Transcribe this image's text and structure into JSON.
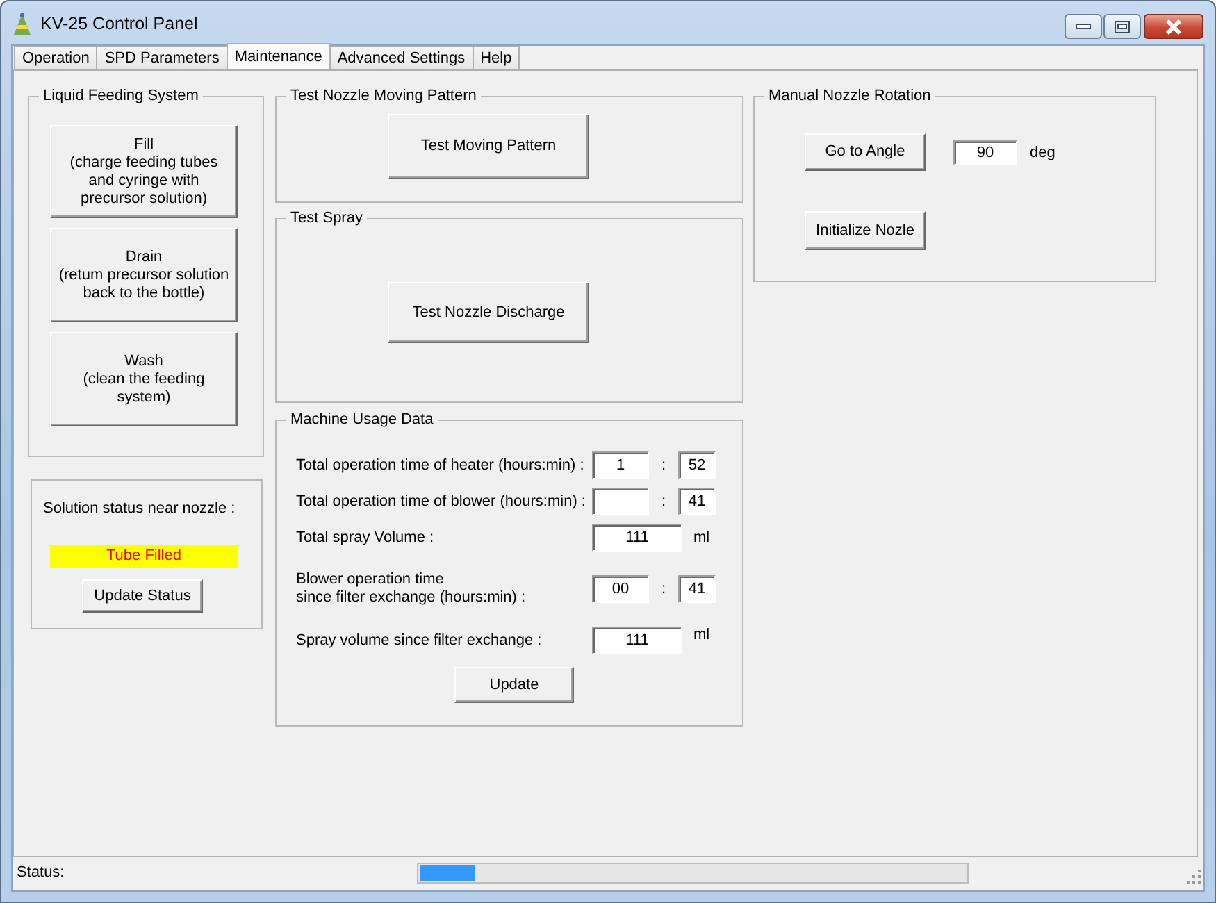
{
  "window": {
    "title": "KV-25 Control Panel"
  },
  "tabs": [
    {
      "label": "Operation",
      "selected": false
    },
    {
      "label": "SPD Parameters",
      "selected": false
    },
    {
      "label": "Maintenance",
      "selected": true
    },
    {
      "label": "Advanced Settings",
      "selected": false
    },
    {
      "label": "Help",
      "selected": false
    }
  ],
  "liquid_feeding_system": {
    "title": "Liquid Feeding System",
    "buttons": [
      {
        "label": "Fill\n(charge feeding tubes\nand cyringe with\nprecursor solution)"
      },
      {
        "label": "Drain\n(retum precursor solution\nback to the bottle)"
      },
      {
        "label": "Wash\n(clean the feeding\nsystem)"
      }
    ]
  },
  "solution_status": {
    "label": "Solution status near nozzle :",
    "status": "Tube Filled",
    "button": "Update Status"
  },
  "test_nozzle_moving_pattern": {
    "title": "Test Nozzle Moving Pattern",
    "button": "Test Moving Pattern"
  },
  "test_spray": {
    "title": "Test Spray",
    "button": "Test Nozzle Discharge"
  },
  "machine_usage_data": {
    "title": "Machine Usage Data",
    "rows": [
      {
        "kind": "time",
        "label": "Total operation time of heater (hours:min) :",
        "hours": "1",
        "separator": ":",
        "minutes": "52"
      },
      {
        "kind": "time",
        "label": "Total operation time of blower (hours:min) :",
        "separator": ":",
        "minutes": "41"
      },
      {
        "kind": "volume",
        "label": "Total spray Volume :",
        "value": "111",
        "unit": "ml"
      },
      {
        "kind": "time",
        "label": "Blower operation time\nsince filter exchange (hours:min) :",
        "hours": "00",
        "separator": ":",
        "minutes": "41"
      },
      {
        "kind": "volume",
        "label": "Spray volume since filter exchange :",
        "value": "111",
        "unit": "ml"
      }
    ],
    "button": "Update"
  },
  "manual_nozzle_rotation": {
    "title": "Manual Nozzle Rotation",
    "go_button": "Go to Angle",
    "angle": "90",
    "unit": "deg",
    "init_button": "Initialize Nozle"
  },
  "status_bar": {
    "label": "Status:",
    "progress": {
      "level": 0.1
    }
  }
}
